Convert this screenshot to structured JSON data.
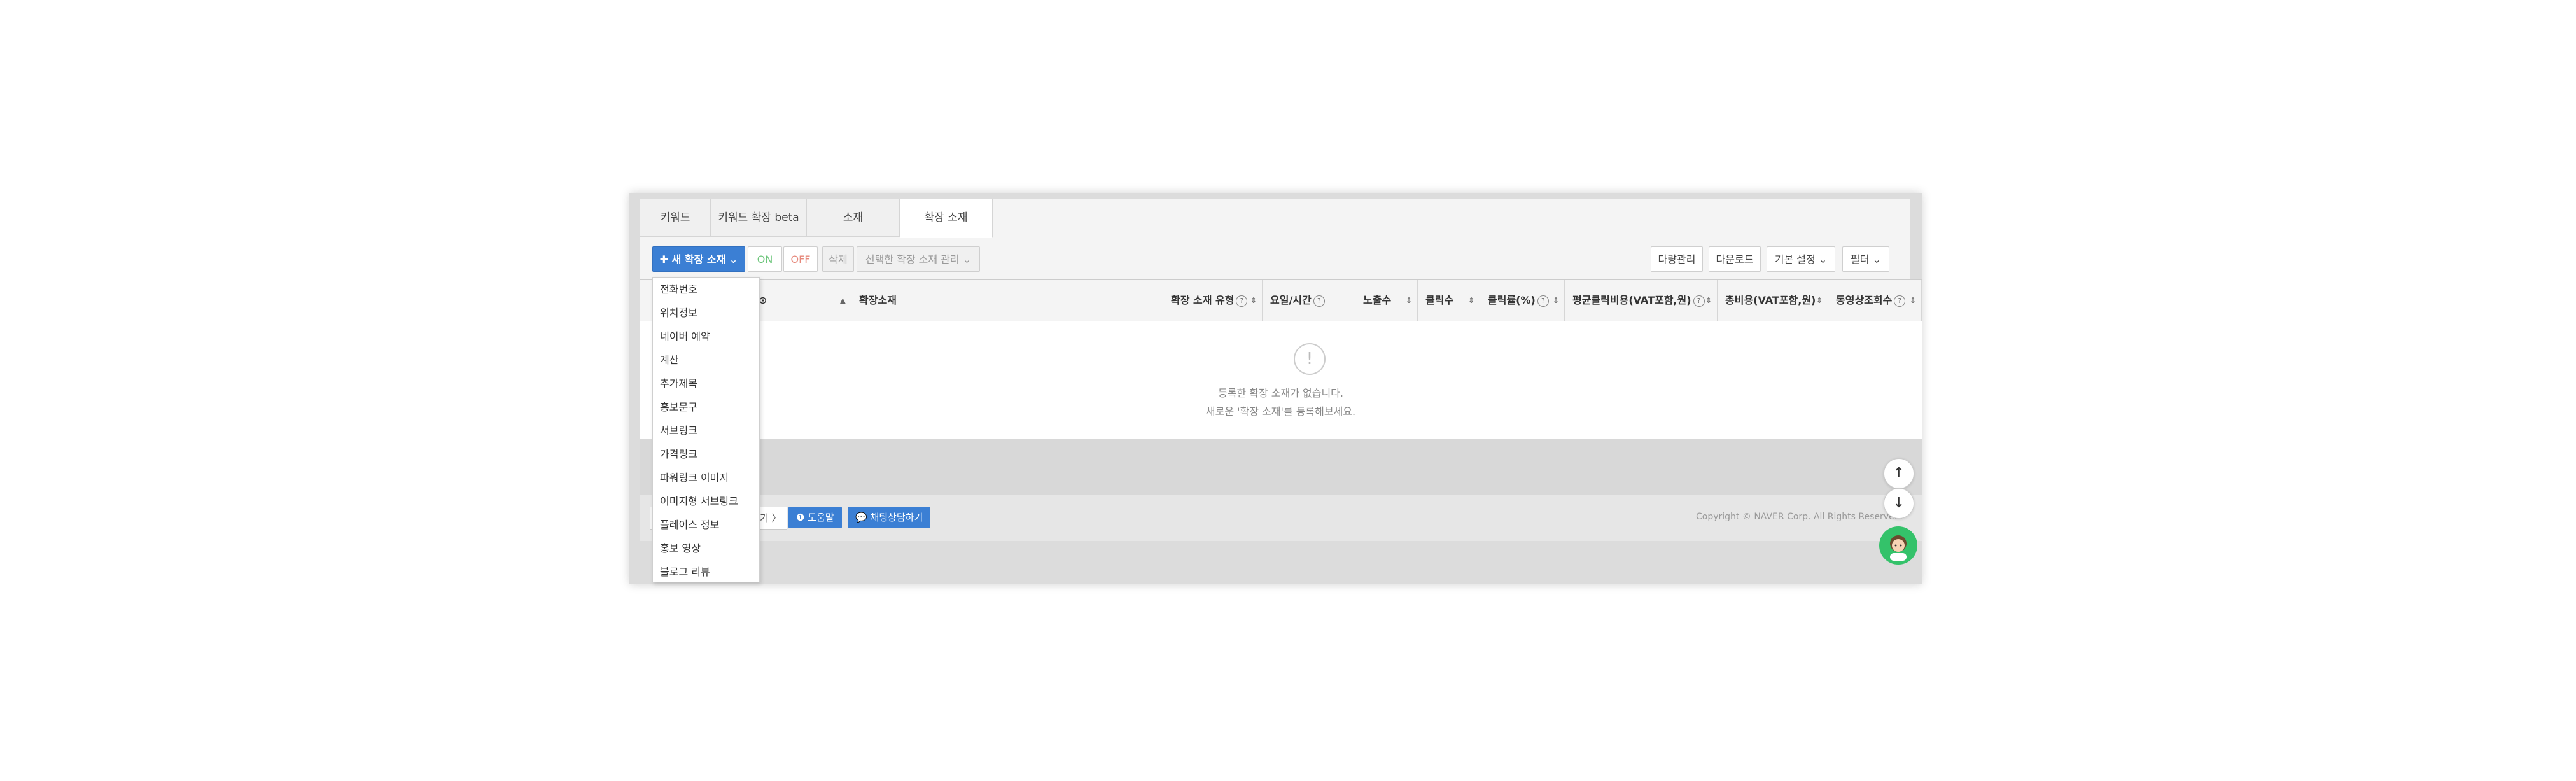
{
  "tabs": [
    {
      "label": "키워드"
    },
    {
      "label": "키워드 확장 beta"
    },
    {
      "label": "소재"
    },
    {
      "label": "확장 소재"
    }
  ],
  "toolbar": {
    "new_button": "✚ 새 확장 소재 ⌄",
    "on": "ON",
    "off": "OFF",
    "delete": "삭제",
    "manage": "선택한 확장 소재 관리 ⌄",
    "bulk": "다량관리",
    "download": "다운로드",
    "settings": "기본 설정 ⌄",
    "filter": "필터 ⌄"
  },
  "table": {
    "columns": [
      {
        "label": "⊙"
      },
      {
        "label": "확장소재"
      },
      {
        "label": "확장 소재 유형"
      },
      {
        "label": "요일/시간"
      },
      {
        "label": "노출수"
      },
      {
        "label": "클릭수"
      },
      {
        "label": "클릭률(%)"
      },
      {
        "label": "평균클릭비용(VAT포함,원)"
      },
      {
        "label": "총비용(VAT포함,원)"
      },
      {
        "label": "동영상조회수"
      }
    ],
    "empty_line1": "등록한 확장 소재가 없습니다.",
    "empty_line2": "새로운 '확장 소재'를 등록해보세요."
  },
  "dropdown": {
    "items": [
      "전화번호",
      "위치정보",
      "네이버 예약",
      "계산",
      "추가제목",
      "홍보문구",
      "서브링크",
      "가격링크",
      "파워링크 이미지",
      "이미지형 서브링크",
      "플레이스 정보",
      "홍보 영상",
      "블로그 리뷰"
    ]
  },
  "footer": {
    "prev_fragment": "기 〉",
    "help": "❶ 도움말",
    "chat": "💬 채팅상담하기",
    "copyright": "Copyright © NAVER Corp. All Rights Reserved."
  },
  "colors": {
    "primary": "#3b7fd4",
    "on": "#6cc57a",
    "off": "#e6877a",
    "chatbot": "#34c26a"
  },
  "icons": [
    "arrow-up-icon",
    "arrow-down-icon",
    "chatbot-avatar-icon",
    "info-icon",
    "sort-icon",
    "help-icon"
  ]
}
